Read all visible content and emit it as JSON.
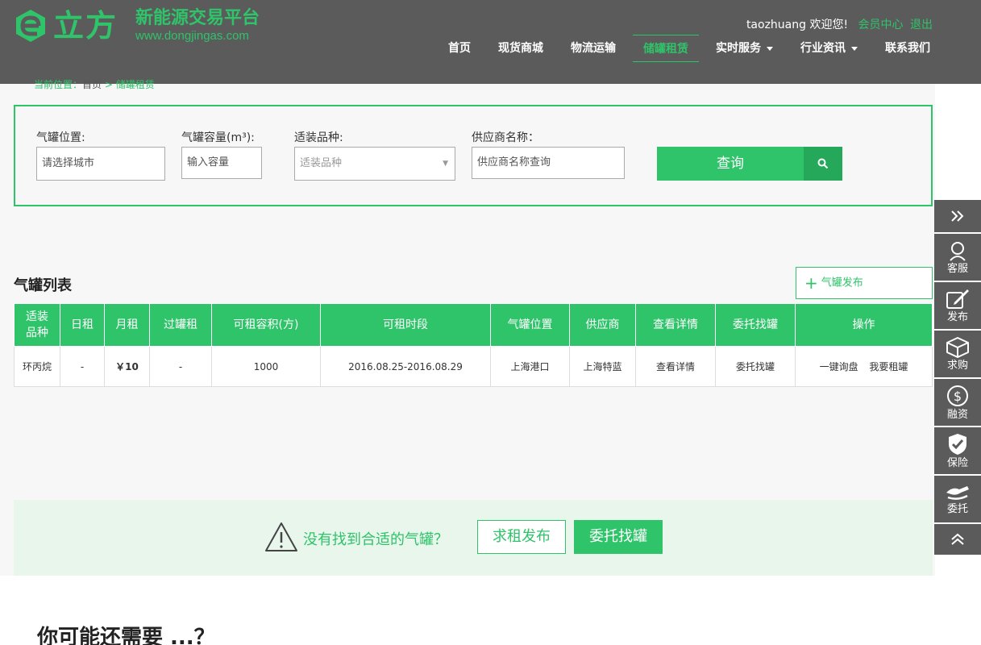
{
  "header": {
    "logo_main": "立方",
    "logo_sub": "新能源交易平台",
    "logo_url": "www.dongjingas.com",
    "username": "taozhuang",
    "welcome": "欢迎您!",
    "member_center": "会员中心",
    "logout": "退出",
    "nav": [
      {
        "label": "首页",
        "dropdown": false,
        "active": false
      },
      {
        "label": "现货商城",
        "dropdown": false,
        "active": false
      },
      {
        "label": "物流运输",
        "dropdown": false,
        "active": false
      },
      {
        "label": "储罐租赁",
        "dropdown": false,
        "active": true
      },
      {
        "label": "实时服务",
        "dropdown": true,
        "active": false
      },
      {
        "label": "行业资讯",
        "dropdown": true,
        "active": false
      },
      {
        "label": "联系我们",
        "dropdown": false,
        "active": false
      }
    ]
  },
  "breadcrumb": {
    "prefix": "当前位置：",
    "home": "首页",
    "sep": ">",
    "current": "储罐租赁"
  },
  "search": {
    "location_label": "气罐位置:",
    "location_placeholder": "请选择城市",
    "capacity_label": "气罐容量(m³):",
    "capacity_placeholder": "输入容量",
    "variety_label": "适装品种:",
    "variety_placeholder": "适装品种",
    "supplier_label": "供应商名称：",
    "supplier_placeholder": "供应商名称查询",
    "button": "查询"
  },
  "list": {
    "title": "气罐列表",
    "publish_button": "气罐发布",
    "columns": [
      "适装品种",
      "日租",
      "月租",
      "过罐租",
      "可租容积(方)",
      "可租时段",
      "气罐位置",
      "供应商",
      "查看详情",
      "委托找罐",
      "操作"
    ],
    "rows": [
      {
        "variety": "环丙烷",
        "daily": "-",
        "monthly": "￥10",
        "transfer": "-",
        "volume": "1000",
        "period": "2016.08.25-2016.08.29",
        "location": "上海港口",
        "supplier": "上海特蓝",
        "detail": "查看详情",
        "entrust": "委托找罐",
        "op_inquiry": "一键询盘",
        "op_rent": "我要租罐"
      }
    ]
  },
  "notice": {
    "text": "没有找到合适的气罐？",
    "btn_request": "求租发布",
    "btn_entrust": "委托找罐"
  },
  "bottom_title": "你可能还需要 ...？",
  "sidebar": {
    "items": [
      "客服",
      "发布",
      "求购",
      "融资",
      "保险",
      "委托"
    ]
  },
  "colors": {
    "accent": "#2fc36a",
    "header_bg": "#5b5b5b",
    "sidebar_bg": "#5b5b5b"
  }
}
